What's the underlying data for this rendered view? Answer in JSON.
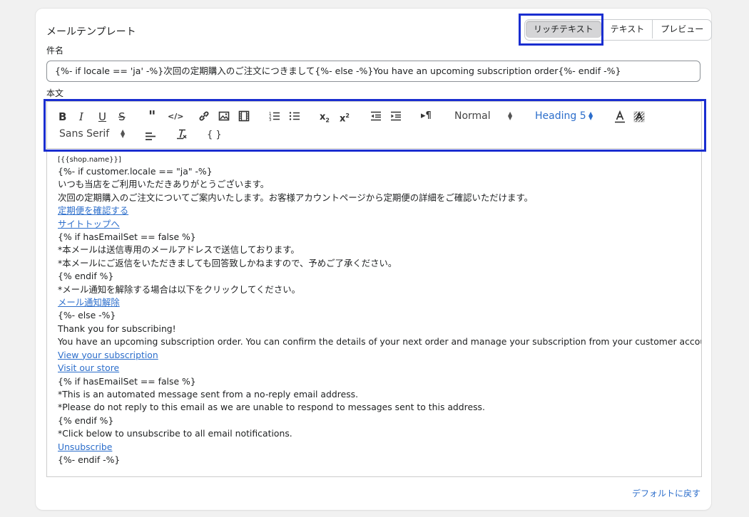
{
  "card": {
    "title": "メールテンプレート",
    "view_tabs": [
      "リッチテキスト",
      "テキスト",
      "プレビュー"
    ],
    "active_tab": "リッチテキスト",
    "subject_label": "件名",
    "subject_value": "{%- if locale == 'ja' -%}次回の定期購入のご注文につきまして{%- else -%}You have an upcoming subscription order{%- endif -%}",
    "body_label": "本文",
    "reset_link": "デフォルトに戻す"
  },
  "toolbar": {
    "format_picker": "Normal",
    "header_picker": "Heading 5",
    "font_picker": "Sans Serif",
    "code_block": "{ }",
    "picker_active_color": "#2c6ecb",
    "icons": [
      "bold-icon",
      "italic-icon",
      "underline-icon",
      "strike-icon",
      "blockquote-icon",
      "code-icon",
      "link-icon",
      "image-icon",
      "video-icon",
      "ordered-list-icon",
      "bullet-list-icon",
      "subscript-icon",
      "superscript-icon",
      "outdent-icon",
      "indent-icon",
      "rtl-icon",
      "color-icon",
      "background-icon",
      "align-icon",
      "clean-icon"
    ]
  },
  "editor": {
    "lines": [
      {
        "text": "[{{shop.name}}]",
        "kind": "small"
      },
      {
        "text": "{%- if customer.locale == \"ja\" -%}",
        "kind": "text"
      },
      {
        "text": "いつも当店をご利用いただきありがとうございます。",
        "kind": "text"
      },
      {
        "text": "次回の定期購入のご注文についてご案内いたします。お客様アカウントページから定期便の詳細をご確認いただけます。",
        "kind": "text"
      },
      {
        "text": " 定期便を確認する ",
        "kind": "link"
      },
      {
        "text": " サイトトップへ ",
        "kind": "link"
      },
      {
        "text": "{% if hasEmailSet == false %}",
        "kind": "text"
      },
      {
        "text": "*本メールは送信専用のメールアドレスで送信しております。",
        "kind": "text"
      },
      {
        "text": "*本メールにご返信をいただきましても回答致しかねますので、予めご了承ください。",
        "kind": "text"
      },
      {
        "text": "{% endif %}",
        "kind": "text"
      },
      {
        "text": "*メール通知を解除する場合は以下をクリックしてください。",
        "kind": "text"
      },
      {
        "text": "メール通知解除",
        "kind": "link"
      },
      {
        "text": "{%- else -%}",
        "kind": "text"
      },
      {
        "text": "Thank you for subscribing!",
        "kind": "text"
      },
      {
        "text": "You have an upcoming subscription order. You can confirm the details of your next order and manage your subscription from your customer account page.",
        "kind": "text"
      },
      {
        "text": " View your subscription ",
        "kind": "link"
      },
      {
        "text": " Visit our store ",
        "kind": "link"
      },
      {
        "text": "{% if hasEmailSet == false %}",
        "kind": "text"
      },
      {
        "text": "*This is an automated message sent from a no-reply email address.",
        "kind": "text"
      },
      {
        "text": "*Please do not reply to this email as we are unable to respond to messages sent to this address.",
        "kind": "text"
      },
      {
        "text": "{% endif %}",
        "kind": "text"
      },
      {
        "text": "*Click below to unsubscribe to all email notifications.",
        "kind": "text"
      },
      {
        "text": "Unsubscribe",
        "kind": "link"
      },
      {
        "text": "{%- endif -%}",
        "kind": "text"
      }
    ]
  },
  "colors": {
    "highlight_border": "#1a2ed0",
    "link": "#2c6ecb",
    "active_tab_bg": "#d5d5d7"
  }
}
